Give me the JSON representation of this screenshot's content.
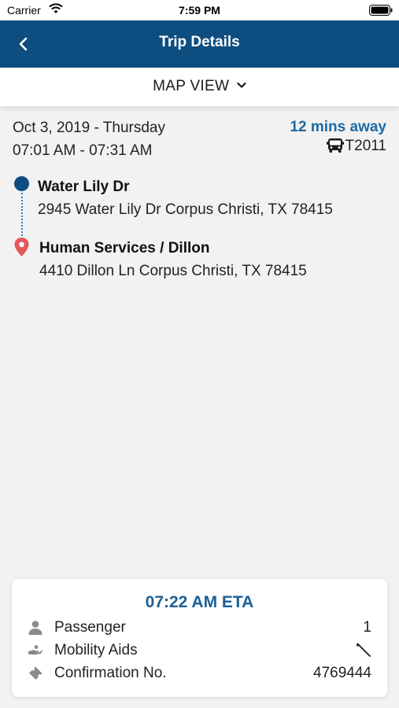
{
  "status_bar": {
    "carrier": "Carrier",
    "time": "7:59 PM"
  },
  "nav": {
    "title": "Trip Details",
    "back_icon": "chevron-left-icon"
  },
  "map_view": {
    "label": "MAP VIEW",
    "icon": "chevron-down-icon"
  },
  "trip": {
    "date": "Oct 3, 2019 - Thursday",
    "time_window": "07:01 AM - 07:31 AM",
    "away": "12 mins away",
    "vehicle_icon": "bus-icon",
    "vehicle_id": "T2011"
  },
  "pickup": {
    "name": "Water Lily Dr",
    "address": "2945 Water Lily Dr Corpus Christi, TX 78415"
  },
  "dropoff": {
    "name": "Human Services / Dillon",
    "address": "4410 Dillon Ln Corpus Christi, TX 78415"
  },
  "card": {
    "eta": "07:22 AM ETA",
    "rows": [
      {
        "icon": "person-icon",
        "label": "Passenger",
        "value": "1"
      },
      {
        "icon": "hand-icon",
        "label": "Mobility Aids",
        "value_icon": "cane-icon"
      },
      {
        "icon": "ticket-icon",
        "label": "Confirmation No.",
        "value": "4769444"
      }
    ]
  },
  "colors": {
    "nav_bg": "#0e4d80",
    "accent": "#1b6aa6",
    "pin": "#e4575a",
    "background": "#f2f2f2"
  }
}
